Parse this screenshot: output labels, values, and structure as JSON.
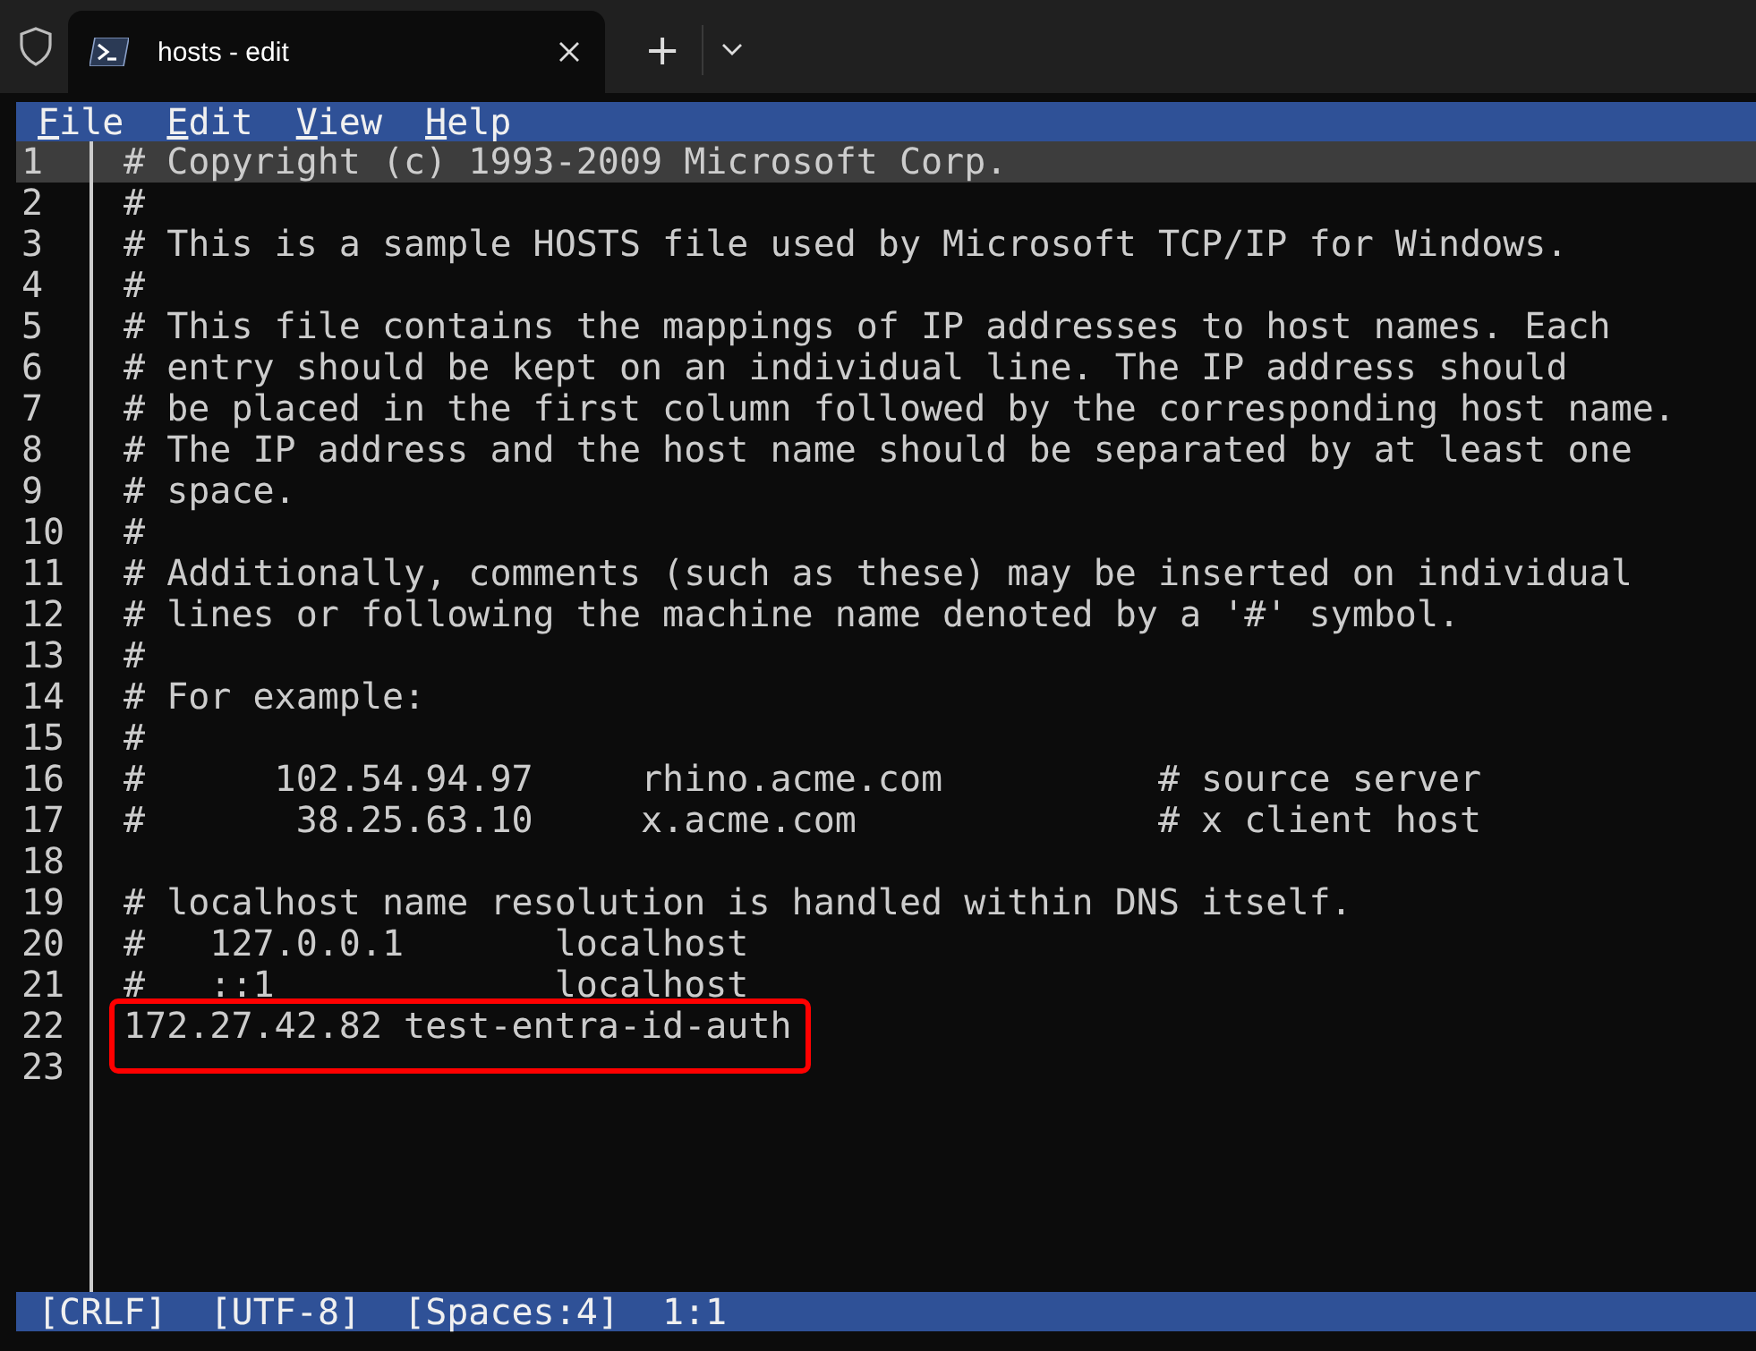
{
  "tabs": [
    {
      "title": "hosts - edit",
      "selected": true
    }
  ],
  "tab_bar": {
    "new_tab": "+"
  },
  "menu": [
    {
      "label": "File"
    },
    {
      "label": "Edit"
    },
    {
      "label": "View"
    },
    {
      "label": "Help"
    }
  ],
  "lines": [
    {
      "number": "1",
      "text": "# Copyright (c) 1993-2009 Microsoft Corp.",
      "current": true,
      "highlighted": false
    },
    {
      "number": "2",
      "text": "#",
      "current": false,
      "highlighted": false
    },
    {
      "number": "3",
      "text": "# This is a sample HOSTS file used by Microsoft TCP/IP for Windows.",
      "current": false,
      "highlighted": false
    },
    {
      "number": "4",
      "text": "#",
      "current": false,
      "highlighted": false
    },
    {
      "number": "5",
      "text": "# This file contains the mappings of IP addresses to host names. Each",
      "current": false,
      "highlighted": false
    },
    {
      "number": "6",
      "text": "# entry should be kept on an individual line. The IP address should",
      "current": false,
      "highlighted": false
    },
    {
      "number": "7",
      "text": "# be placed in the first column followed by the corresponding host name.",
      "current": false,
      "highlighted": false
    },
    {
      "number": "8",
      "text": "# The IP address and the host name should be separated by at least one",
      "current": false,
      "highlighted": false
    },
    {
      "number": "9",
      "text": "# space.",
      "current": false,
      "highlighted": false
    },
    {
      "number": "10",
      "text": "#",
      "current": false,
      "highlighted": false
    },
    {
      "number": "11",
      "text": "# Additionally, comments (such as these) may be inserted on individual",
      "current": false,
      "highlighted": false
    },
    {
      "number": "12",
      "text": "# lines or following the machine name denoted by a '#' symbol.",
      "current": false,
      "highlighted": false
    },
    {
      "number": "13",
      "text": "#",
      "current": false,
      "highlighted": false
    },
    {
      "number": "14",
      "text": "# For example:",
      "current": false,
      "highlighted": false
    },
    {
      "number": "15",
      "text": "#",
      "current": false,
      "highlighted": false
    },
    {
      "number": "16",
      "text": "#      102.54.94.97     rhino.acme.com          # source server",
      "current": false,
      "highlighted": false
    },
    {
      "number": "17",
      "text": "#       38.25.63.10     x.acme.com              # x client host",
      "current": false,
      "highlighted": false
    },
    {
      "number": "18",
      "current": false,
      "highlighted": false
    },
    {
      "number": "19",
      "text": "# localhost name resolution is handled within DNS itself.",
      "current": false,
      "highlighted": false
    },
    {
      "number": "20",
      "text": "#   127.0.0.1       localhost",
      "current": false,
      "highlighted": false
    },
    {
      "number": "21",
      "text": "#   ::1             localhost",
      "current": false,
      "highlighted": false
    },
    {
      "number": "22",
      "text": "172.27.42.82 test-entra-id-auth",
      "current": false,
      "highlighted": true
    },
    {
      "number": "23",
      "current": false,
      "highlighted": false
    }
  ],
  "status_bar": [
    "[CRLF]",
    "[UTF-8]",
    "[Spaces:4]",
    "1:1"
  ]
}
